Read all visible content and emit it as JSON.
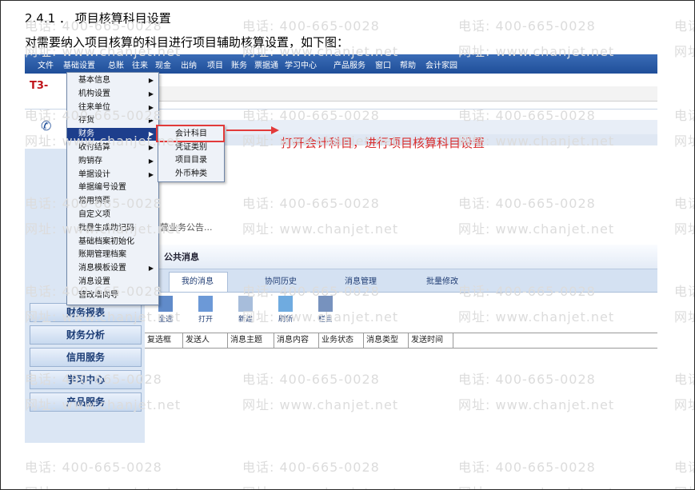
{
  "doc": {
    "section_title": "2.4.1 ． 项目核算科目设置",
    "intro": "对需要纳入项目核算的科目进行项目辅助核算设置，如下图："
  },
  "app": {
    "logo": "T3-",
    "menubar": [
      "文件",
      "基础设置",
      "总账",
      "往来",
      "现金",
      "出纳",
      "项目",
      "账务",
      "票据通",
      "学习中心",
      "产品服务",
      "窗口",
      "帮助",
      "会计家园"
    ],
    "submenu_level1": [
      {
        "label": "基本信息",
        "arrow": true
      },
      {
        "label": "机构设置",
        "arrow": true
      },
      {
        "label": "往来单位",
        "arrow": true
      },
      {
        "label": "存货",
        "arrow": true
      },
      {
        "label": "财务",
        "arrow": true,
        "selected": true
      },
      {
        "label": "收付结算",
        "arrow": true
      },
      {
        "label": "购销存",
        "arrow": true
      },
      {
        "label": "单据设计",
        "arrow": true
      },
      {
        "label": "单据编号设置",
        "arrow": false
      },
      {
        "label": "常用摘要",
        "arrow": false
      },
      {
        "label": "自定义项",
        "arrow": false
      },
      {
        "label": "批量生成助记码",
        "arrow": false
      },
      {
        "label": "基础档案初始化",
        "arrow": false
      },
      {
        "label": "账期管理档案",
        "arrow": false
      },
      {
        "label": "消息模板设置",
        "arrow": true
      },
      {
        "label": "消息设置",
        "arrow": false
      },
      {
        "label": "营改增向导",
        "arrow": false
      }
    ],
    "submenu_level2": [
      "会计科目",
      "凭证类别",
      "项目目录",
      "外币种类"
    ],
    "annotation": "打开会计科目，进行项目核算科目设置",
    "left_nav": [
      "财务报表",
      "财务分析",
      "信用服务",
      "学习中心",
      "产品服务"
    ],
    "notice_text": "告营业务公告...",
    "panel_title": "公共消息",
    "tabs": [
      "我的消息",
      "协同历史",
      "消息管理",
      "批量修改"
    ],
    "toolbar": [
      "全选",
      "打开",
      "新建",
      "刷新",
      "栏目"
    ],
    "grid_columns": [
      "复选框",
      "发送人",
      "消息主题",
      "消息内容",
      "业务状态",
      "消息类型",
      "发送时间"
    ]
  },
  "watermark": {
    "phone": "电话: 400-665-0028",
    "site": "网址: www.chanjet.net"
  }
}
